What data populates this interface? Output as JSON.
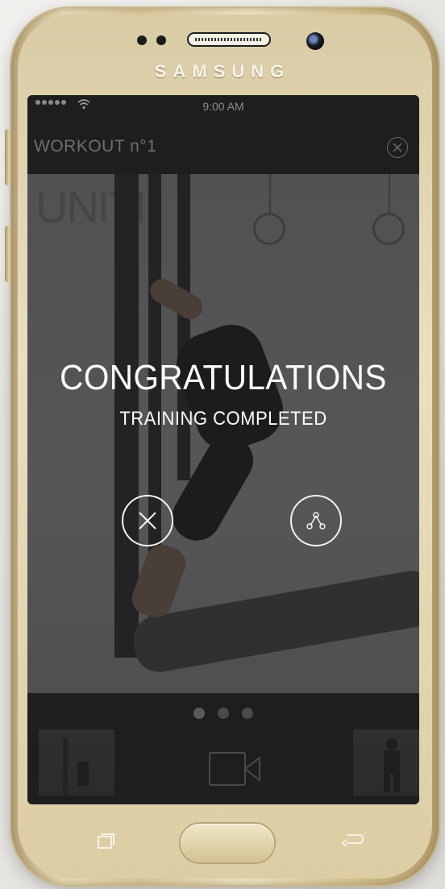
{
  "device": {
    "brand": "SAMSUNG"
  },
  "status_bar": {
    "time": "9:00 AM",
    "signal_icon": "signal-dots-icon",
    "wifi_icon": "wifi-icon"
  },
  "header": {
    "title": "WORKOUT n°1",
    "close_icon": "close-circle-icon"
  },
  "message": {
    "title": "CONGRATULATIONS",
    "subtitle": "TRAINING COMPLETED"
  },
  "actions": {
    "dismiss_icon": "close-circle-icon",
    "share_icon": "share-icon"
  },
  "pager": {
    "pages": 3,
    "active": 0
  },
  "bottom": {
    "video_icon": "video-camera-icon"
  },
  "colors": {
    "overlay": "#202022",
    "text": "#fbfbfb",
    "phone_gold": "#d9c89c"
  }
}
